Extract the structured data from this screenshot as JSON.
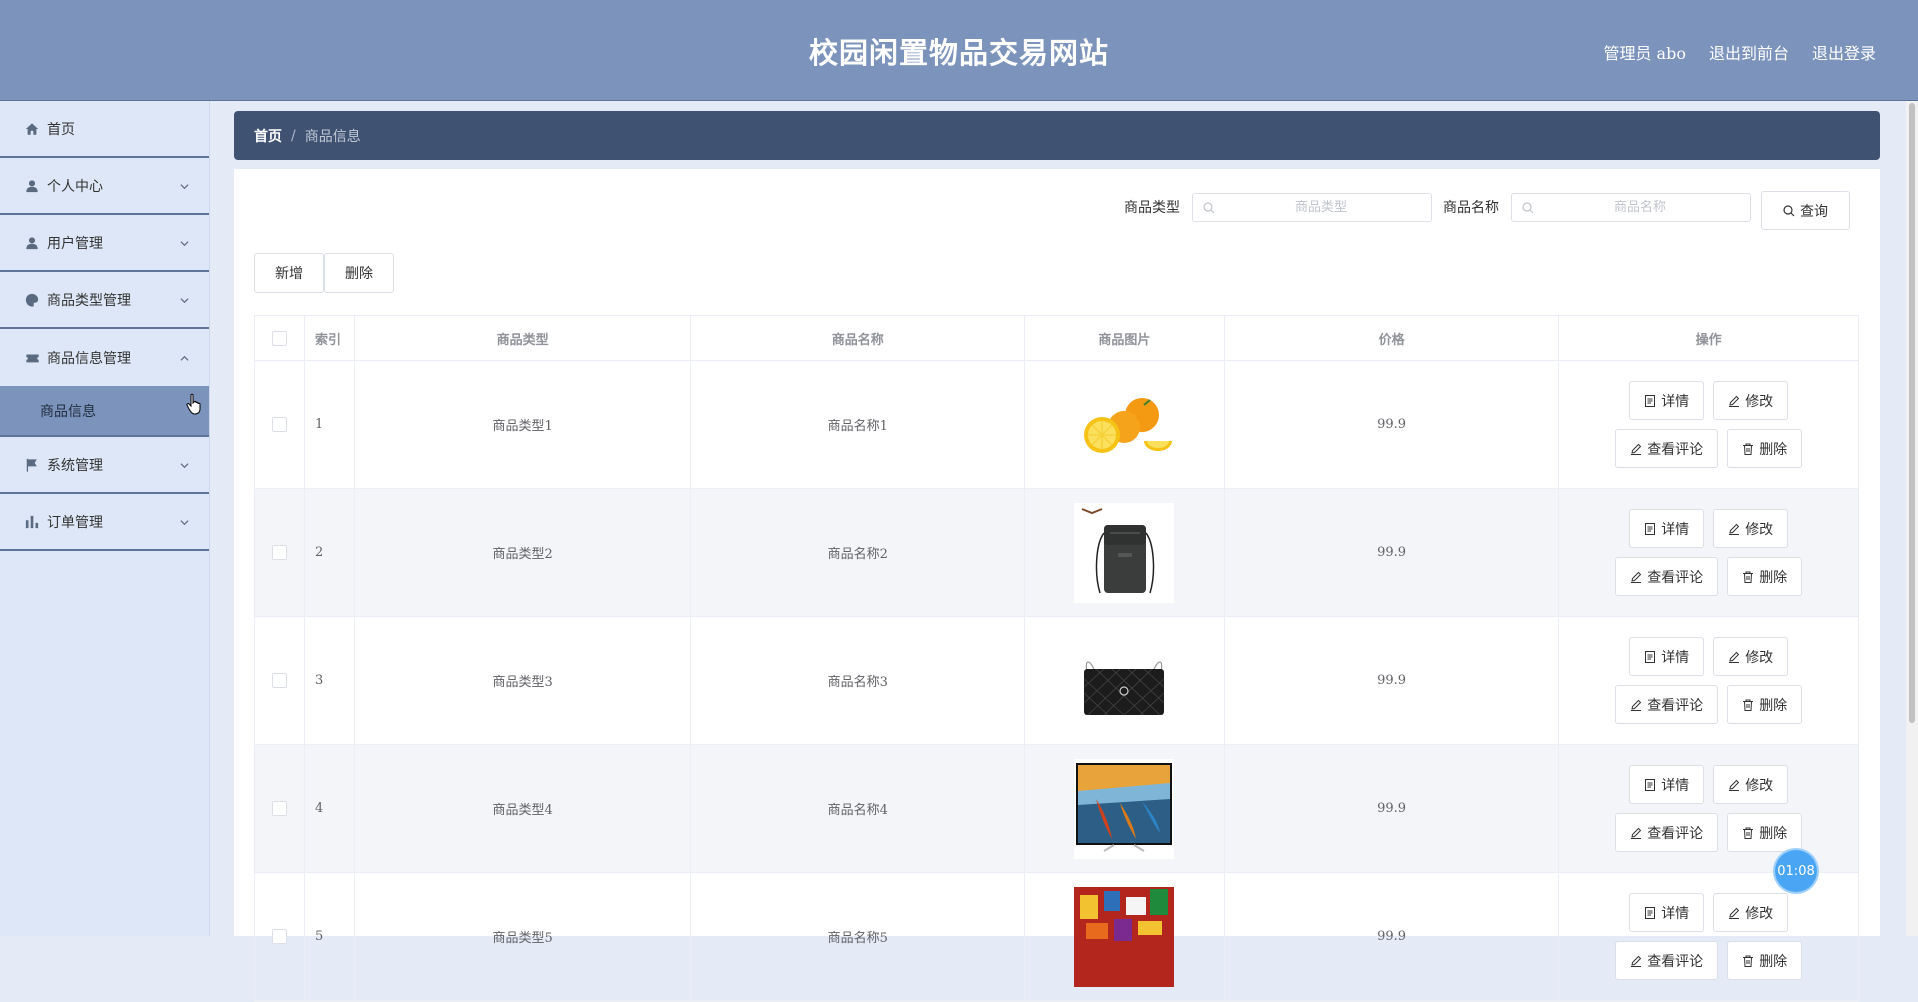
{
  "header": {
    "title": "校园闲置物品交易网站",
    "admin_label": "管理员 abo",
    "to_front_label": "退出到前台",
    "logout_label": "退出登录"
  },
  "sidebar": {
    "items": [
      {
        "label": "首页",
        "icon": "home-icon"
      },
      {
        "label": "个人中心",
        "icon": "user-icon"
      },
      {
        "label": "用户管理",
        "icon": "user-icon"
      },
      {
        "label": "商品类型管理",
        "icon": "paint-drop-icon"
      },
      {
        "label": "商品信息管理",
        "icon": "ticket-icon",
        "expanded": true,
        "sub": [
          {
            "label": "商品信息"
          }
        ]
      },
      {
        "label": "系统管理",
        "icon": "flag-icon"
      },
      {
        "label": "订单管理",
        "icon": "bar-chart-icon"
      }
    ]
  },
  "breadcrumb": {
    "home": "首页",
    "separator": "/",
    "current": "商品信息"
  },
  "search": {
    "type_label": "商品类型",
    "type_placeholder": "商品类型",
    "name_label": "商品名称",
    "name_placeholder": "商品名称",
    "query_button": "查询"
  },
  "actions": {
    "add_button": "新增",
    "delete_button": "删除"
  },
  "table": {
    "columns": [
      "索引",
      "商品类型",
      "商品名称",
      "商品图片",
      "价格",
      "操作"
    ],
    "rows": [
      {
        "index": "1",
        "type": "商品类型1",
        "name": "商品名称1",
        "image": "oranges",
        "price": "99.9"
      },
      {
        "index": "2",
        "type": "商品类型2",
        "name": "商品名称2",
        "image": "shoulder-bag",
        "price": "99.9"
      },
      {
        "index": "3",
        "type": "商品类型3",
        "name": "商品名称3",
        "image": "quilted-handbag",
        "price": "99.9"
      },
      {
        "index": "4",
        "type": "商品类型4",
        "name": "商品名称4",
        "image": "tv-kayak",
        "price": "99.9"
      },
      {
        "index": "5",
        "type": "商品类型5",
        "name": "商品名称5",
        "image": "snack-pile",
        "price": "99.9"
      }
    ],
    "row_actions": {
      "detail": "详情",
      "edit": "修改",
      "comments": "查看评论",
      "delete": "删除"
    }
  },
  "timer": "01:08",
  "colors": {
    "header_bg": "#7c93bc",
    "sidebar_bg": "#dde7f7",
    "breadcrumb_bg": "#3f5272",
    "active_sub_bg": "#7c93bc",
    "timer_bg": "#4aa6f4"
  }
}
